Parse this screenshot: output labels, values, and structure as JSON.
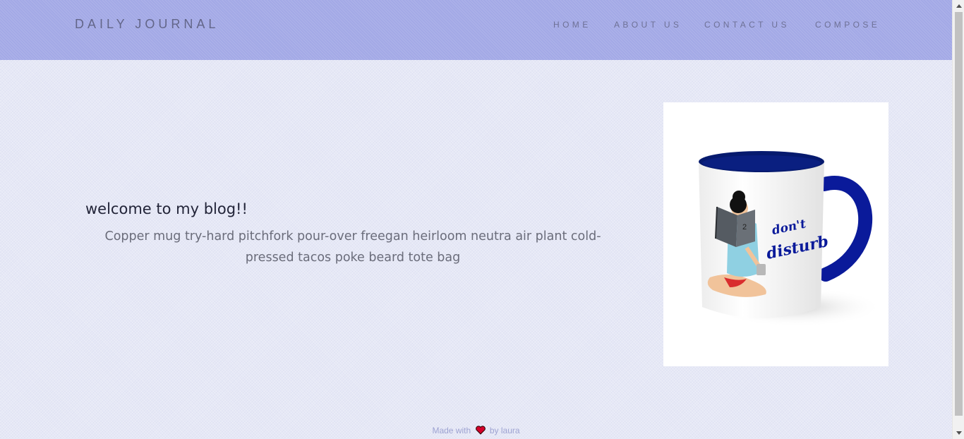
{
  "nav": {
    "brand": "DAILY JOURNAL",
    "links": [
      "HOME",
      "ABOUT US",
      "CONTACT US",
      "COMPOSE"
    ]
  },
  "main": {
    "heading": "welcome to my blog!!",
    "blurb": "Copper mug try-hard pitchfork pour-over freegan heirloom neutra air plant cold-pressed tacos poke beard tote bag",
    "image": {
      "mug_text_line1": "don't",
      "mug_text_line2": "disturb",
      "book_text": "2"
    }
  },
  "footer": {
    "made_with": "Made with",
    "by": "by laura"
  },
  "colors": {
    "navbar": "#a3a9e6",
    "background": "#e6e8f6",
    "mug_accent": "#0a1a9a"
  },
  "icons": {
    "heart": "heart-icon",
    "scroll_up": "scroll-up-arrow-icon",
    "scroll_down": "scroll-down-arrow-icon"
  }
}
